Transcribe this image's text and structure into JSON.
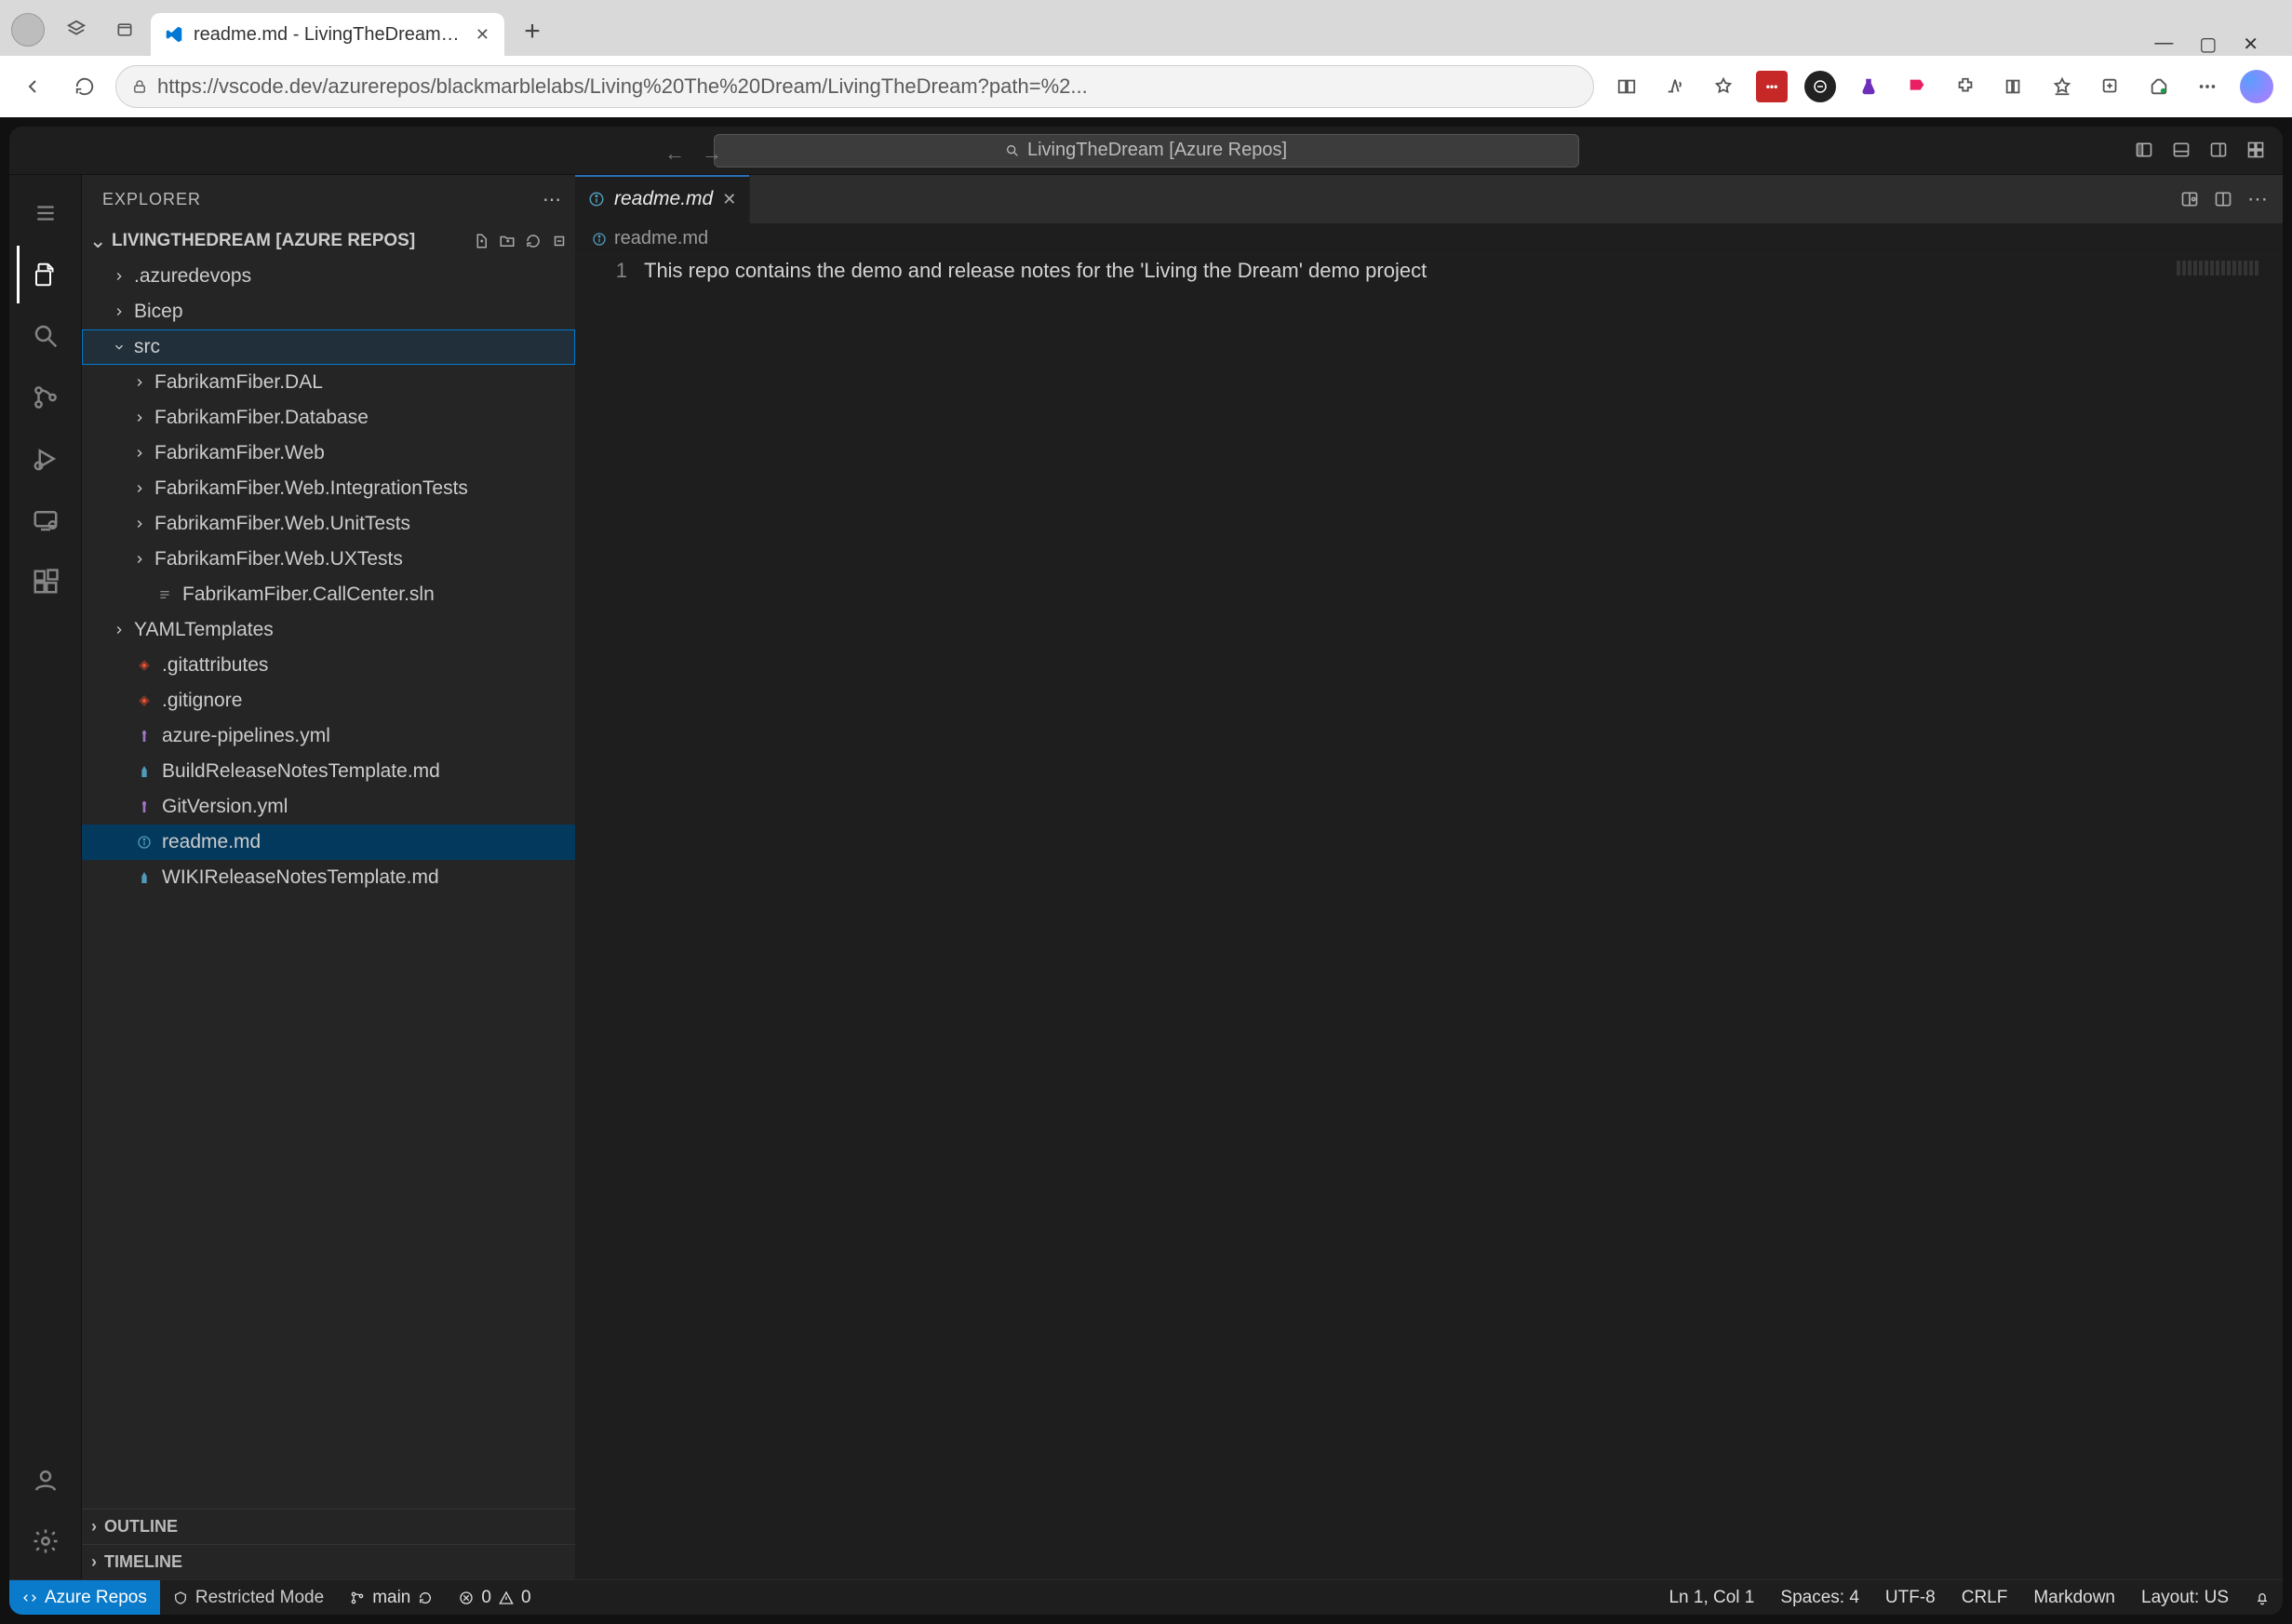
{
  "browser": {
    "tab_title": "readme.md - LivingTheDream [Az",
    "url": "https://vscode.dev/azurerepos/blackmarblelabs/Living%20The%20Dream/LivingTheDream?path=%2...",
    "ext_red_label": "•••"
  },
  "cmdcenter": {
    "text": "LivingTheDream [Azure Repos]"
  },
  "sidebar": {
    "title": "EXPLORER",
    "section": "LIVINGTHEDREAM [AZURE REPOS]",
    "tree": [
      {
        "indent": 1,
        "kind": "folder",
        "open": false,
        "label": ".azuredevops"
      },
      {
        "indent": 1,
        "kind": "folder",
        "open": false,
        "label": "Bicep"
      },
      {
        "indent": 1,
        "kind": "folder",
        "open": true,
        "label": "src",
        "focused": true
      },
      {
        "indent": 2,
        "kind": "folder",
        "open": false,
        "label": "FabrikamFiber.DAL"
      },
      {
        "indent": 2,
        "kind": "folder",
        "open": false,
        "label": "FabrikamFiber.Database"
      },
      {
        "indent": 2,
        "kind": "folder",
        "open": false,
        "label": "FabrikamFiber.Web"
      },
      {
        "indent": 2,
        "kind": "folder",
        "open": false,
        "label": "FabrikamFiber.Web.IntegrationTests"
      },
      {
        "indent": 2,
        "kind": "folder",
        "open": false,
        "label": "FabrikamFiber.Web.UnitTests"
      },
      {
        "indent": 2,
        "kind": "folder",
        "open": false,
        "label": "FabrikamFiber.Web.UXTests"
      },
      {
        "indent": 2,
        "kind": "file",
        "icon": "txt",
        "label": "FabrikamFiber.CallCenter.sln"
      },
      {
        "indent": 1,
        "kind": "folder",
        "open": false,
        "label": "YAMLTemplates"
      },
      {
        "indent": 1,
        "kind": "file",
        "icon": "git",
        "label": ".gitattributes"
      },
      {
        "indent": 1,
        "kind": "file",
        "icon": "git",
        "label": ".gitignore"
      },
      {
        "indent": 1,
        "kind": "file",
        "icon": "yaml",
        "label": "azure-pipelines.yml"
      },
      {
        "indent": 1,
        "kind": "file",
        "icon": "mark",
        "label": "BuildReleaseNotesTemplate.md"
      },
      {
        "indent": 1,
        "kind": "file",
        "icon": "yaml",
        "label": "GitVersion.yml"
      },
      {
        "indent": 1,
        "kind": "file",
        "icon": "info",
        "label": "readme.md",
        "selected": true
      },
      {
        "indent": 1,
        "kind": "file",
        "icon": "mark",
        "label": "WIKIReleaseNotesTemplate.md"
      }
    ],
    "outline": "OUTLINE",
    "timeline": "TIMELINE"
  },
  "editor": {
    "tab": "readme.md",
    "breadcrumb": "readme.md",
    "line_no": "1",
    "line_text": "This repo contains the demo and release notes for the 'Living the Dream' demo project"
  },
  "status": {
    "azure": "Azure Repos",
    "restricted": "Restricted Mode",
    "branch": "main",
    "errors": "0",
    "warnings": "0",
    "lncol": "Ln 1, Col 1",
    "spaces": "Spaces: 4",
    "encoding": "UTF-8",
    "eol": "CRLF",
    "lang": "Markdown",
    "layout": "Layout: US"
  }
}
